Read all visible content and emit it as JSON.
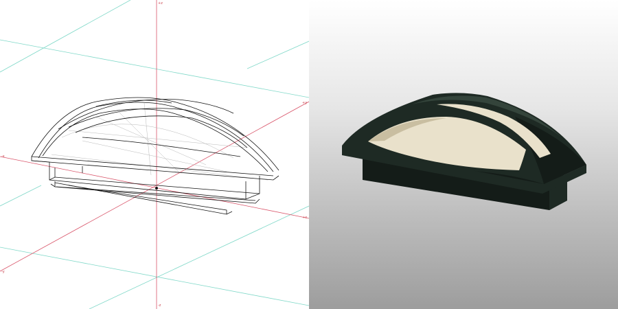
{
  "viewports": {
    "wireframe": {
      "view": "wireframe",
      "axis_labels": {
        "z_top": "+z",
        "z_bottom": "-z",
        "y_right": "+y",
        "x_left": "-x",
        "x_right": "+x",
        "y_left": "-y"
      },
      "colors": {
        "axis": "#d9556a",
        "grid": "#7fd8c8",
        "wire": "#111111"
      }
    },
    "shaded": {
      "view": "shaded",
      "colors": {
        "body": "#1e2a24",
        "body_dark": "#141c18",
        "body_light": "#34443b",
        "lens": "#e9e1cb",
        "lens_shadow": "#c9bea1",
        "background_top": "#ffffff",
        "background_bottom": "#9d9d9d"
      }
    }
  }
}
